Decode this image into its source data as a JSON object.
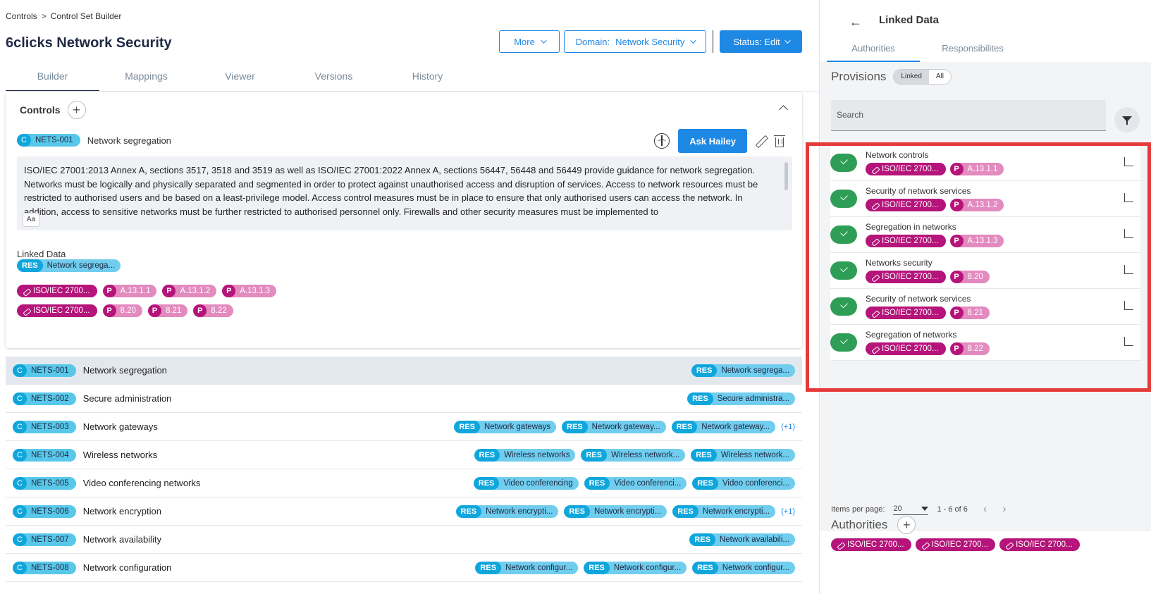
{
  "breadcrumb": [
    "Controls",
    "Control Set Builder"
  ],
  "breadcrumb_sep": ">",
  "page_title": "6clicks Network Security",
  "actions": {
    "more": "More",
    "domain_label": "Domain:",
    "domain_value": "Network Security",
    "status": "Status: Edit"
  },
  "tabs": [
    "Builder",
    "Mappings",
    "Viewer",
    "Versions",
    "History"
  ],
  "controls_card": {
    "title": "Controls",
    "plus": "+",
    "control_id": "NETS-001",
    "control_prefix": "C",
    "control_name": "Network segregation",
    "ask_button": "Ask Hailey",
    "description": "ISO/IEC 27001:2013 Annex A, sections 3517, 3518 and 3519 as well as ISO/IEC 27001:2022 Annex A, sections 56447, 56448 and 56449 provide guidance for network segregation. Networks must be logically and physically separated and segmented in order to protect against unauthorised access and disruption of services. Access to network resources must be restricted to authorised users and be based on a least-privilege model. Access control measures must be in place to ensure that only authorised users can access the network. In addition, access to sensitive networks must be further restricted to authorised personnel only. Firewalls and other security measures must be implemented to",
    "font_button": "Aa",
    "linked_label": "Linked Data",
    "linked_res": "Network segrega...",
    "res_prefix": "RES",
    "authority_line1": {
      "authority": "ISO/IEC 2700...",
      "provisions": [
        "A.13.1.1",
        "A.13.1.2",
        "A.13.1.3"
      ]
    },
    "authority_line2": {
      "authority": "ISO/IEC 2700...",
      "provisions": [
        "8.20",
        "8.21",
        "8.22"
      ]
    },
    "p_prefix": "P"
  },
  "table": [
    {
      "id": "NETS-001",
      "name": "Network segregation",
      "res": [
        "Network segrega..."
      ],
      "more": "",
      "selected": true
    },
    {
      "id": "NETS-002",
      "name": "Secure administration",
      "res": [
        "Secure administra..."
      ],
      "more": ""
    },
    {
      "id": "NETS-003",
      "name": "Network gateways",
      "res": [
        "Network gateways",
        "Network gateway...",
        "Network gateway..."
      ],
      "more": "(+1)"
    },
    {
      "id": "NETS-004",
      "name": "Wireless networks",
      "res": [
        "Wireless networks",
        "Wireless network...",
        "Wireless network..."
      ],
      "more": ""
    },
    {
      "id": "NETS-005",
      "name": "Video conferencing networks",
      "res": [
        "Video conferencing",
        "Video conferenci...",
        "Video conferenci..."
      ],
      "more": ""
    },
    {
      "id": "NETS-006",
      "name": "Network encryption",
      "res": [
        "Network encrypti...",
        "Network encrypti...",
        "Network encrypti..."
      ],
      "more": "(+1)"
    },
    {
      "id": "NETS-007",
      "name": "Network availability",
      "res": [
        "Network availabili..."
      ],
      "more": ""
    },
    {
      "id": "NETS-008",
      "name": "Network configuration",
      "res": [
        "Network configur...",
        "Network configur...",
        "Network configur..."
      ],
      "more": ""
    }
  ],
  "panel": {
    "back": "←",
    "title": "Linked Data",
    "tabs": [
      "Authorities",
      "Responsibilites"
    ],
    "provisions_title": "Provisions",
    "toggle": [
      "Linked",
      "All"
    ],
    "search_placeholder": "Search",
    "provisions": [
      {
        "title": "Network controls",
        "authority": "ISO/IEC 2700...",
        "ref": "A.13.1.1"
      },
      {
        "title": "Security of network services",
        "authority": "ISO/IEC 2700...",
        "ref": "A.13.1.2"
      },
      {
        "title": "Segregation in networks",
        "authority": "ISO/IEC 2700...",
        "ref": "A.13.1.3"
      },
      {
        "title": "Networks security",
        "authority": "ISO/IEC 2700...",
        "ref": "8.20"
      },
      {
        "title": "Security of network services",
        "authority": "ISO/IEC 2700...",
        "ref": "8.21"
      },
      {
        "title": "Segregation of networks",
        "authority": "ISO/IEC 2700...",
        "ref": "8.22"
      }
    ],
    "pager": {
      "label": "Items per page:",
      "per_page": "20",
      "range": "1 - 6 of 6"
    },
    "authorities_title": "Authorities",
    "authorities": [
      "ISO/IEC 2700...",
      "ISO/IEC 2700...",
      "ISO/IEC 2700..."
    ]
  },
  "colors": {
    "primary": "#1e88e5",
    "authority": "#b5147a",
    "provision": "#e38abf",
    "res": "#70cdee",
    "check": "#2e9e57",
    "highlight": "#e53a3a"
  }
}
